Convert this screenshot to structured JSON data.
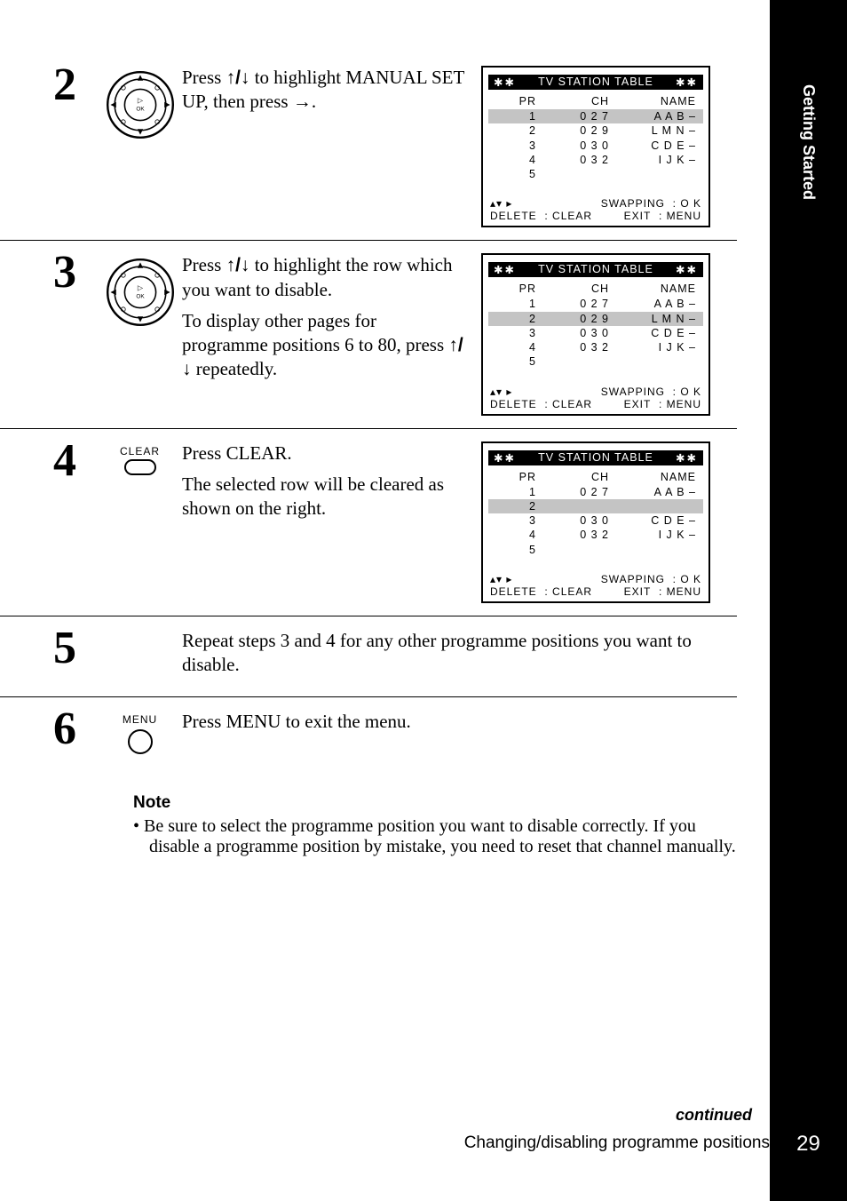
{
  "section": "Getting Started",
  "page_number": "29",
  "footer_continued": "continued",
  "footer_caption": "Changing/disabling programme positions",
  "glyphs": {
    "updown": "↑/↓",
    "right": "→",
    "avright": "▴▾ ▸"
  },
  "tv_table": {
    "title_stars": "✱✱",
    "title": "TV STATION TABLE",
    "head": {
      "pr": "PR",
      "ch": "CH",
      "name": "NAME"
    },
    "rows_full": [
      {
        "pr": "1",
        "ch": "0 2 7",
        "name": "A A B –"
      },
      {
        "pr": "2",
        "ch": "0 2 9",
        "name": "L M N –"
      },
      {
        "pr": "3",
        "ch": "0 3 0",
        "name": "C D E –"
      },
      {
        "pr": "4",
        "ch": "0 3 2",
        "name": "I J K –"
      },
      {
        "pr": "5",
        "ch": "",
        "name": ""
      }
    ],
    "rows_cleared": [
      {
        "pr": "1",
        "ch": "0 2 7",
        "name": "A A B –"
      },
      {
        "pr": "2",
        "ch": "",
        "name": ""
      },
      {
        "pr": "3",
        "ch": "0 3 0",
        "name": "C D E –"
      },
      {
        "pr": "4",
        "ch": "0 3 2",
        "name": "I J K –"
      },
      {
        "pr": "5",
        "ch": "",
        "name": ""
      }
    ],
    "swapping": "SWAPPING",
    "ok": ": O K",
    "delete": "DELETE",
    "clear": ": CLEAR",
    "exit": "EXIT",
    "menu": ": MENU"
  },
  "steps": {
    "s2": {
      "num": "2",
      "text_a": "Press ",
      "text_b": " to highlight MANUAL SET UP, then press ",
      "text_c": "."
    },
    "s3": {
      "num": "3",
      "text_a": "Press ",
      "text_b": " to highlight the row which you want to disable.",
      "p2a": "To display other pages for programme positions 6 to 80, press ",
      "p2b": " repeatedly."
    },
    "s4": {
      "num": "4",
      "btn_label": "CLEAR",
      "p1": "Press CLEAR.",
      "p2": "The selected row will be cleared as shown on the right."
    },
    "s5": {
      "num": "5",
      "p1": "Repeat steps 3 and 4 for any other programme positions you want to disable."
    },
    "s6": {
      "num": "6",
      "btn_label": "MENU",
      "p1": "Press MENU to exit the menu."
    }
  },
  "note": {
    "heading": "Note",
    "item": "Be sure to select the programme position you want to disable correctly.  If you disable a programme position by mistake, you need to reset that channel manually."
  }
}
